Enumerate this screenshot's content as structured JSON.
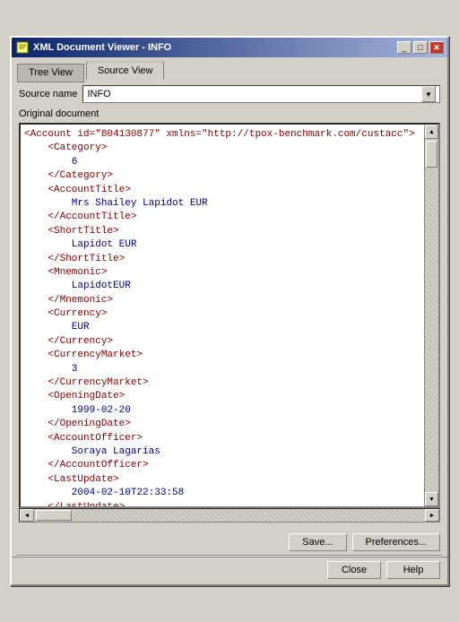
{
  "window": {
    "title": "XML Document Viewer - INFO",
    "icon": "📄"
  },
  "tabs": [
    {
      "label": "Tree View",
      "active": false
    },
    {
      "label": "Source View",
      "active": true
    }
  ],
  "source_name": {
    "label": "Source name",
    "value": "INFO"
  },
  "original_doc_label": "Original document",
  "xml_lines": [
    {
      "indent": 0,
      "type": "tag",
      "text": "<Account id=\"804130877\" xmlns=\"http://tpox-benchmark.com/custacc\">"
    },
    {
      "indent": 1,
      "type": "tag",
      "text": "    <Category>"
    },
    {
      "indent": 2,
      "type": "value",
      "text": "        6"
    },
    {
      "indent": 1,
      "type": "tag",
      "text": "    </Category>"
    },
    {
      "indent": 1,
      "type": "tag",
      "text": "    <AccountTitle>"
    },
    {
      "indent": 2,
      "type": "value",
      "text": "        Mrs Shailey Lapidot EUR"
    },
    {
      "indent": 1,
      "type": "tag",
      "text": "    </AccountTitle>"
    },
    {
      "indent": 1,
      "type": "tag",
      "text": "    <ShortTitle>"
    },
    {
      "indent": 2,
      "type": "value",
      "text": "        Lapidot EUR"
    },
    {
      "indent": 1,
      "type": "tag",
      "text": "    </ShortTitle>"
    },
    {
      "indent": 1,
      "type": "tag",
      "text": "    <Mnemonic>"
    },
    {
      "indent": 2,
      "type": "value",
      "text": "        LapidotEUR"
    },
    {
      "indent": 1,
      "type": "tag",
      "text": "    </Mnemonic>"
    },
    {
      "indent": 1,
      "type": "tag",
      "text": "    <Currency>"
    },
    {
      "indent": 2,
      "type": "value",
      "text": "        EUR"
    },
    {
      "indent": 1,
      "type": "tag",
      "text": "    </Currency>"
    },
    {
      "indent": 1,
      "type": "tag",
      "text": "    <CurrencyMarket>"
    },
    {
      "indent": 2,
      "type": "value",
      "text": "        3"
    },
    {
      "indent": 1,
      "type": "tag",
      "text": "    </CurrencyMarket>"
    },
    {
      "indent": 1,
      "type": "tag",
      "text": "    <OpeningDate>"
    },
    {
      "indent": 2,
      "type": "value",
      "text": "        1999-02-20"
    },
    {
      "indent": 1,
      "type": "tag",
      "text": "    </OpeningDate>"
    },
    {
      "indent": 1,
      "type": "tag",
      "text": "    <AccountOfficer>"
    },
    {
      "indent": 2,
      "type": "value",
      "text": "        Soraya Lagarias"
    },
    {
      "indent": 1,
      "type": "tag",
      "text": "    </AccountOfficer>"
    },
    {
      "indent": 1,
      "type": "tag",
      "text": "    <LastUpdate>"
    },
    {
      "indent": 2,
      "type": "value",
      "text": "        2004-02-10T22:33:58"
    },
    {
      "indent": 1,
      "type": "tag",
      "text": "    </LastUpdate>"
    }
  ],
  "buttons": {
    "save": "Save...",
    "preferences": "Preferences...",
    "close": "Close",
    "help": "Help"
  },
  "scrollbar": {
    "up_arrow": "▲",
    "down_arrow": "▼",
    "left_arrow": "◄",
    "right_arrow": "►"
  }
}
